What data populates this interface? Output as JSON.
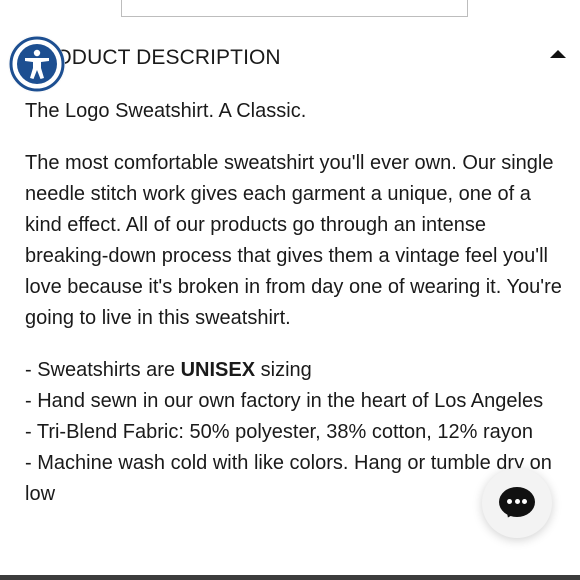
{
  "section": {
    "title": "PRODUCT DESCRIPTION",
    "expanded": true
  },
  "description": {
    "tagline": "The Logo Sweatshirt. A Classic.",
    "body": "The most comfortable sweatshirt you'll ever own. Our single needle stitch work gives each garment a unique, one of a kind effect. All of our products go through an intense breaking-down process that gives them a vintage feel you'll love because it's broken in from day one of wearing it. You're going to live in this sweatshirt.",
    "bullets": [
      {
        "prefix": "- Sweatshirts are ",
        "bold": "UNISEX",
        "suffix": " sizing"
      },
      {
        "text": "- Hand sewn in our own factory in the heart of Los Angeles"
      },
      {
        "text": "- Tri-Blend Fabric: 50% polyester, 38% cotton, 12% rayon"
      },
      {
        "text": "- Machine wash cold with like colors. Hang or tumble dry on low"
      }
    ]
  },
  "icons": {
    "accessibility": "accessibility-icon",
    "collapse": "caret-up-icon",
    "chat": "chat-icon"
  },
  "colors": {
    "accessibility_blue": "#1d4f91",
    "text": "#1a1a1a",
    "chat_button_bg": "#f3f3f3"
  }
}
